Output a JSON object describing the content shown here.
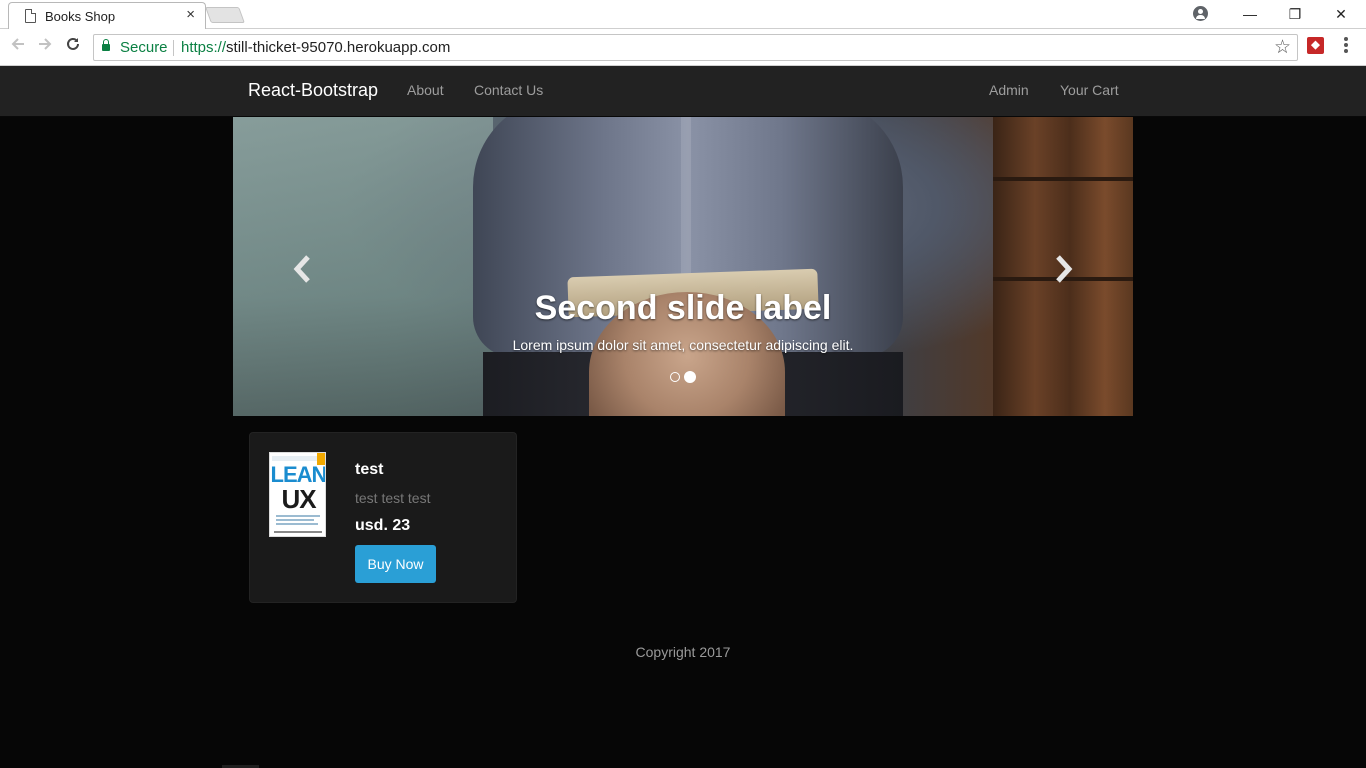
{
  "browser": {
    "tab_title": "Books Shop",
    "tab_close": "×",
    "secure_label": "Secure",
    "url_scheme": "https://",
    "url_rest": "still-thicket-95070.herokuapp.com",
    "icons": [
      "page-icon",
      "back-arrow-icon",
      "forward-arrow-icon",
      "reload-icon",
      "lock-icon",
      "star-icon",
      "extension-icon",
      "menu-icon",
      "profile-icon"
    ],
    "window_buttons": {
      "minimize": "—",
      "restore": "❐",
      "close": "✕"
    }
  },
  "navbar": {
    "brand": "React-Bootstrap",
    "left_links": [
      "About",
      "Contact Us"
    ],
    "right_links": [
      "Admin",
      "Your Cart"
    ]
  },
  "carousel": {
    "caption_title": "Second slide label",
    "caption_text": "Lorem ipsum dolor sit amet, consectetur adipiscing elit.",
    "prev_icon": "‹",
    "next_icon": "›",
    "slide_count": 2,
    "active_slide": 2
  },
  "products": [
    {
      "title": "test",
      "description": "test test test",
      "price": "usd. 23",
      "button_label": "Buy Now",
      "cover": {
        "line1": "LEAN",
        "line2": "UX"
      }
    }
  ],
  "footer": {
    "text": "Copyright 2017"
  },
  "colors": {
    "page_bg": "#060606",
    "navbar_bg": "#222222",
    "nav_link": "#9d9d9d",
    "card_bg": "#1a1a1a",
    "button_bg": "#2a9fd6",
    "secure_green": "#0b8043"
  }
}
